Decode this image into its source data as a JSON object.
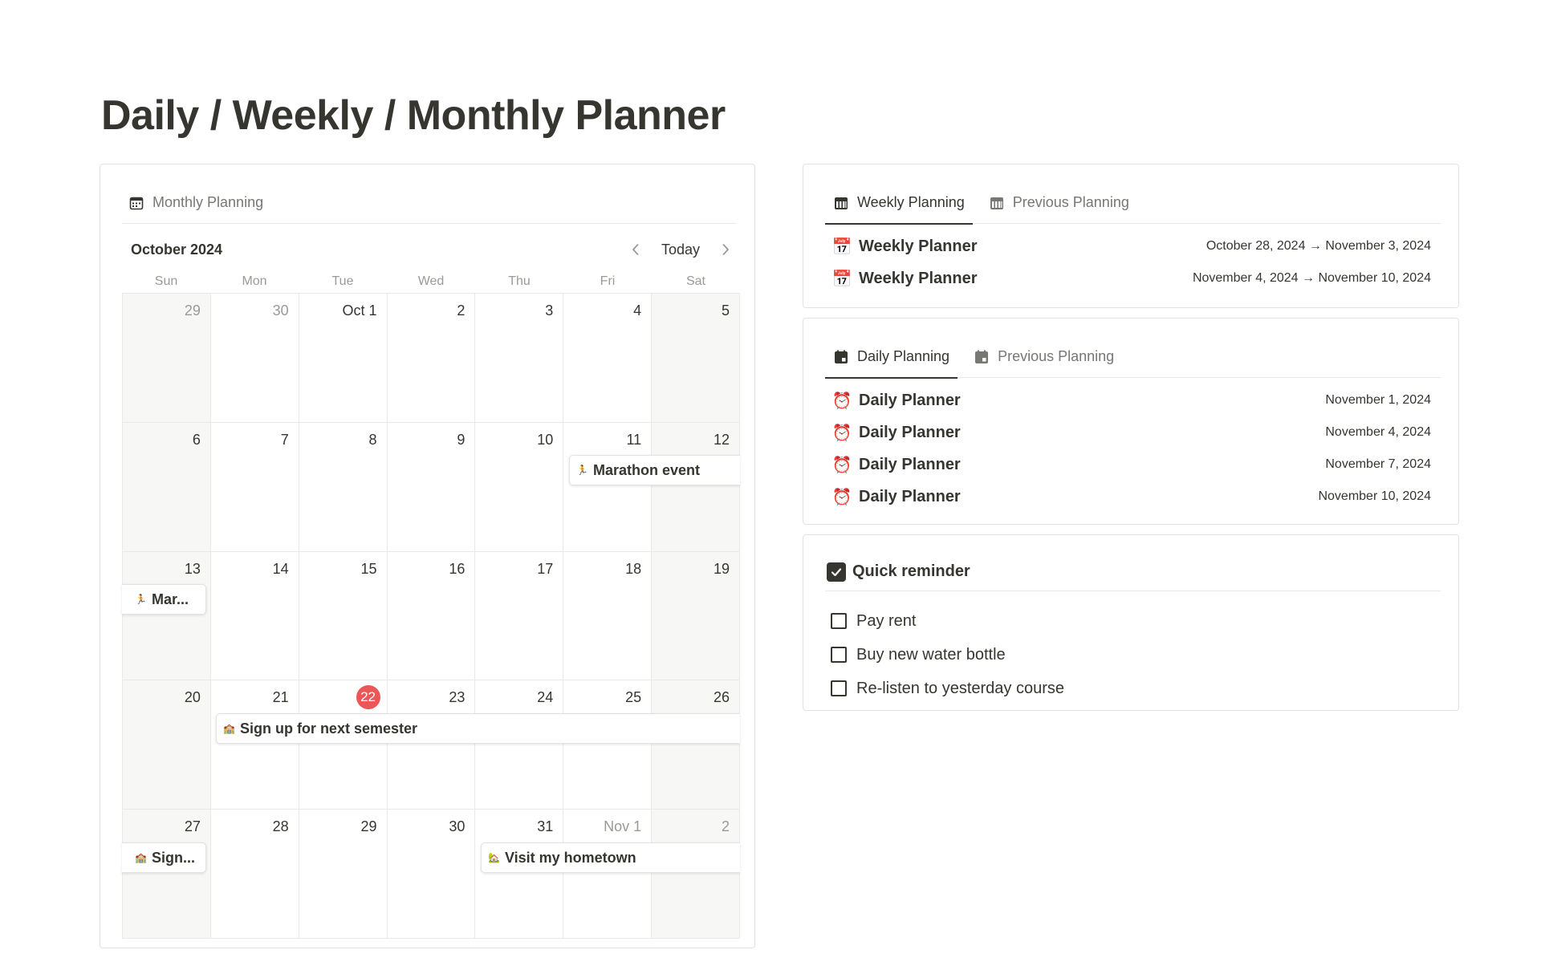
{
  "page": {
    "title": "Daily / Weekly / Monthly Planner"
  },
  "monthly": {
    "tab_label": "Monthly Planning",
    "month_label": "October 2024",
    "today_label": "Today",
    "weekdays": [
      "Sun",
      "Mon",
      "Tue",
      "Wed",
      "Thu",
      "Fri",
      "Sat"
    ],
    "days": [
      {
        "label": "29",
        "muted": true
      },
      {
        "label": "30",
        "muted": true
      },
      {
        "label": "Oct 1"
      },
      {
        "label": "2"
      },
      {
        "label": "3"
      },
      {
        "label": "4"
      },
      {
        "label": "5"
      },
      {
        "label": "6"
      },
      {
        "label": "7"
      },
      {
        "label": "8"
      },
      {
        "label": "9"
      },
      {
        "label": "10"
      },
      {
        "label": "11"
      },
      {
        "label": "12"
      },
      {
        "label": "13"
      },
      {
        "label": "14"
      },
      {
        "label": "15"
      },
      {
        "label": "16"
      },
      {
        "label": "17"
      },
      {
        "label": "18"
      },
      {
        "label": "19"
      },
      {
        "label": "20"
      },
      {
        "label": "21"
      },
      {
        "label": "22",
        "today": true
      },
      {
        "label": "23"
      },
      {
        "label": "24"
      },
      {
        "label": "25"
      },
      {
        "label": "26"
      },
      {
        "label": "27"
      },
      {
        "label": "28"
      },
      {
        "label": "29"
      },
      {
        "label": "30"
      },
      {
        "label": "31"
      },
      {
        "label": "Nov 1",
        "muted": true
      },
      {
        "label": "2",
        "muted": true
      }
    ],
    "events": [
      {
        "label": "Marathon event",
        "emoji": "🏃",
        "week": 1,
        "start": 5,
        "end": 6
      },
      {
        "label": "Mar...",
        "emoji": "🏃",
        "week": 2,
        "start": 0,
        "end": 0
      },
      {
        "label": "Sign up for next semester",
        "emoji": "🏫",
        "week": 3,
        "start": 1,
        "end": 6
      },
      {
        "label": "Sign...",
        "emoji": "🏫",
        "week": 4,
        "start": 0,
        "end": 0
      },
      {
        "label": "Visit my hometown",
        "emoji": "🏡",
        "week": 4,
        "start": 4,
        "end": 6
      }
    ]
  },
  "weekly": {
    "tabs": [
      "Weekly Planning",
      "Previous Planning"
    ],
    "items": [
      {
        "emoji": "📅",
        "name": "Weekly Planner",
        "date": "October 28, 2024 → November 3, 2024"
      },
      {
        "emoji": "📅",
        "name": "Weekly Planner",
        "date": "November 4, 2024 → November 10, 2024"
      }
    ]
  },
  "daily": {
    "tabs": [
      "Daily Planning",
      "Previous Planning"
    ],
    "items": [
      {
        "emoji": "⏰",
        "name": "Daily Planner",
        "date": "November 1, 2024"
      },
      {
        "emoji": "⏰",
        "name": "Daily Planner",
        "date": "November 4, 2024"
      },
      {
        "emoji": "⏰",
        "name": "Daily Planner",
        "date": "November 7, 2024"
      },
      {
        "emoji": "⏰",
        "name": "Daily Planner",
        "date": "November 10, 2024"
      }
    ]
  },
  "reminder": {
    "title": "Quick reminder",
    "items": [
      "Pay rent",
      "Buy new water bottle",
      "Re-listen to yesterday course"
    ]
  },
  "colors": {
    "text": "#37352f",
    "muted": "#9b9a97",
    "border": "#e9e9e7",
    "today": "#eb5757",
    "weekend_bg": "#f7f7f5"
  }
}
